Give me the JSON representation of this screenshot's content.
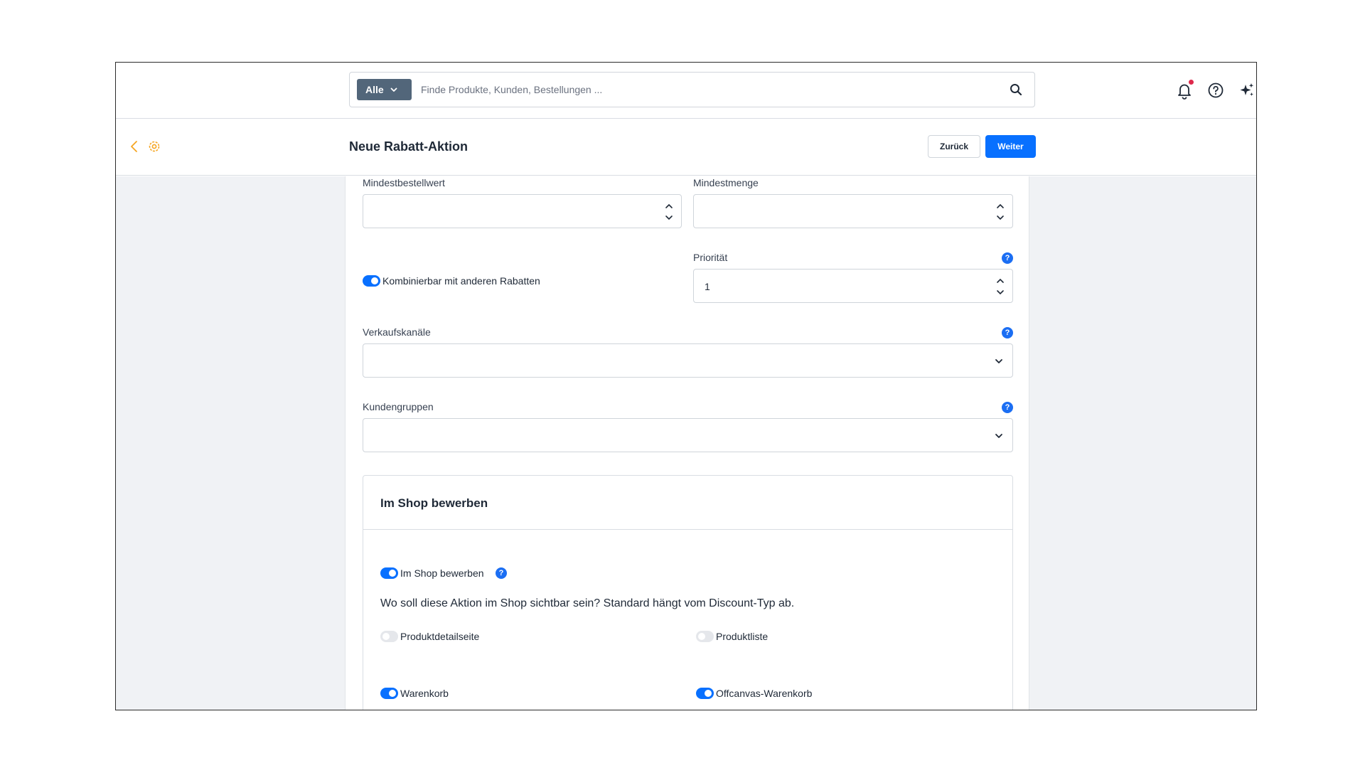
{
  "topbar": {
    "search_scope": "Alle",
    "search_placeholder": "Finde Produkte, Kunden, Bestellungen ..."
  },
  "header": {
    "title": "Neue Rabatt-Aktion",
    "back_label": "Zurück",
    "next_label": "Weiter"
  },
  "form": {
    "min_order_value_label": "Mindestbestellwert",
    "min_order_value": "",
    "min_quantity_label": "Mindestmenge",
    "min_quantity": "",
    "combinable_label": "Kombinierbar mit anderen Rabatten",
    "combinable": true,
    "priority_label": "Priorität",
    "priority_value": "1",
    "sales_channels_label": "Verkaufskanäle",
    "customer_groups_label": "Kundengruppen",
    "help_glyph": "?"
  },
  "promote": {
    "title": "Im Shop bewerben",
    "toggle_label": "Im Shop bewerben",
    "hint": "Wo soll diese Aktion im Shop sichtbar sein? Standard hängt vom Discount-Typ ab.",
    "options": [
      {
        "label": "Produktdetailseite",
        "on": false
      },
      {
        "label": "Produktliste",
        "on": false
      },
      {
        "label": "Warenkorb",
        "on": true
      },
      {
        "label": "Offcanvas-Warenkorb",
        "on": true
      }
    ]
  },
  "colors": {
    "primary": "#0870ff",
    "accent_orange": "#f5a623",
    "scope_bg": "#52667a",
    "notification_dot": "#de294c"
  }
}
